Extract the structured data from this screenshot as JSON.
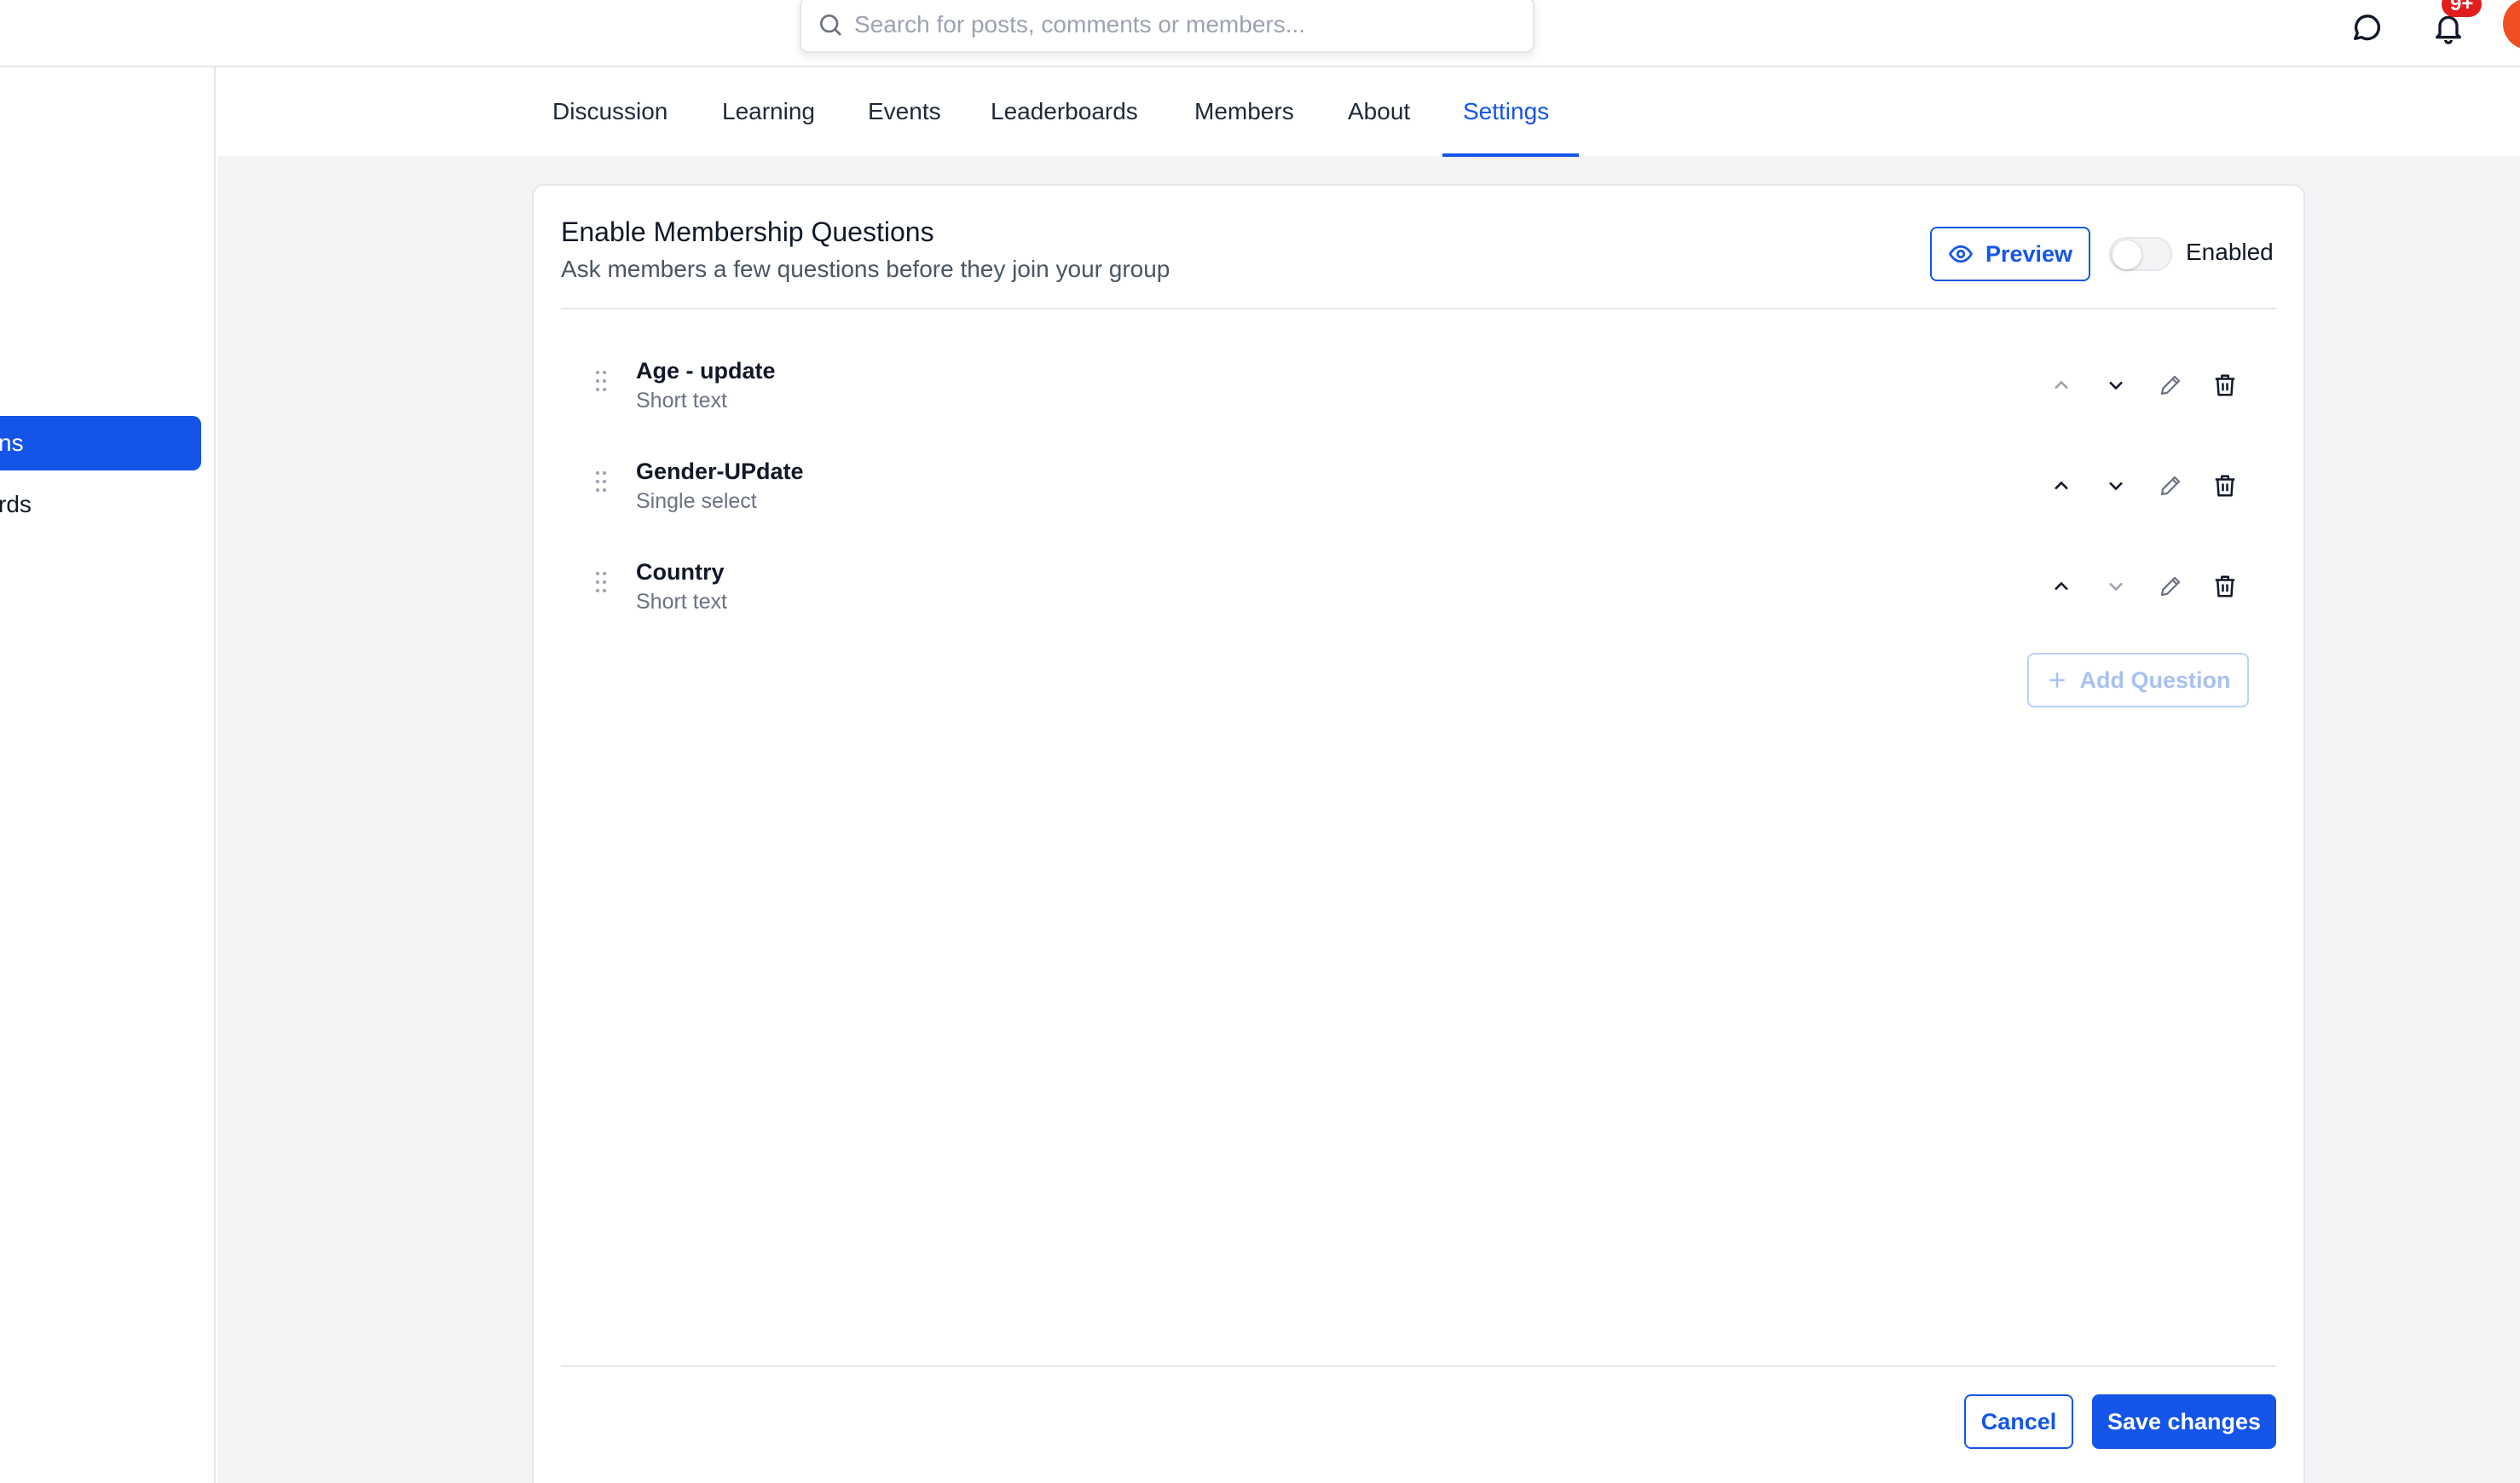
{
  "search": {
    "placeholder": "Search for posts, comments or members..."
  },
  "header": {
    "notification_badge": "9+"
  },
  "sidebar": {
    "items": [
      {
        "label": "ns"
      },
      {
        "label": "rds"
      }
    ]
  },
  "tabs": [
    {
      "label": "Discussion"
    },
    {
      "label": "Learning"
    },
    {
      "label": "Events"
    },
    {
      "label": "Leaderboards"
    },
    {
      "label": "Members"
    },
    {
      "label": "About"
    },
    {
      "label": "Settings"
    }
  ],
  "card": {
    "title": "Enable Membership Questions",
    "subtitle": "Ask members a few questions before they join your group",
    "preview_label": "Preview",
    "toggle_label": "Enabled"
  },
  "questions": [
    {
      "title": "Age - update",
      "type": "Short text"
    },
    {
      "title": "Gender-UPdate",
      "type": "Single select"
    },
    {
      "title": "Country",
      "type": "Short text"
    }
  ],
  "add_question_label": "Add Question",
  "footer": {
    "cancel_label": "Cancel",
    "save_label": "Save changes"
  },
  "colors": {
    "accent": "#1455e8",
    "badge": "#e11d1d",
    "avatar": "#f04e23"
  }
}
